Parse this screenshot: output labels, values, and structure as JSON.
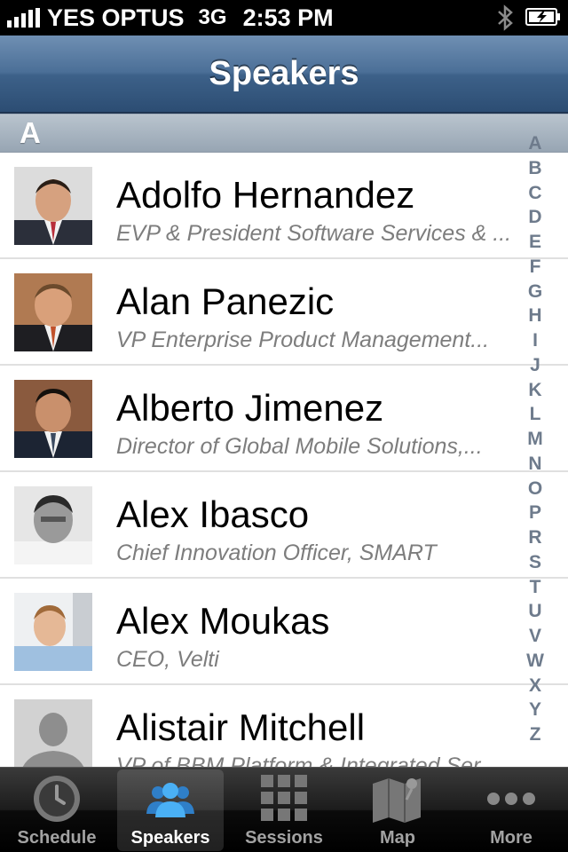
{
  "status_bar": {
    "carrier": "YES OPTUS",
    "network": "3G",
    "time": "2:53 PM"
  },
  "nav": {
    "title": "Speakers"
  },
  "section": {
    "letter": "A"
  },
  "speakers": [
    {
      "name": "Adolfo Hernandez",
      "title": "EVP & President Software Services & ..."
    },
    {
      "name": "Alan Panezic",
      "title": "VP Enterprise Product Management..."
    },
    {
      "name": "Alberto Jimenez",
      "title": "Director of Global Mobile Solutions,..."
    },
    {
      "name": "Alex Ibasco",
      "title": "Chief Innovation Officer, SMART"
    },
    {
      "name": "Alex Moukas",
      "title": "CEO, Velti"
    },
    {
      "name": "Alistair Mitchell",
      "title": "VP of BBM Platform & Integrated Ser..."
    }
  ],
  "index": [
    "A",
    "B",
    "C",
    "D",
    "E",
    "F",
    "G",
    "H",
    "I",
    "J",
    "K",
    "L",
    "M",
    "N",
    "O",
    "P",
    "R",
    "S",
    "T",
    "U",
    "V",
    "W",
    "X",
    "Y",
    "Z"
  ],
  "tabs": [
    {
      "label": "Schedule",
      "icon": "clock-icon",
      "selected": false
    },
    {
      "label": "Speakers",
      "icon": "people-icon",
      "selected": true
    },
    {
      "label": "Sessions",
      "icon": "grid-icon",
      "selected": false
    },
    {
      "label": "Map",
      "icon": "map-icon",
      "selected": false
    },
    {
      "label": "More",
      "icon": "more-icon",
      "selected": false
    }
  ],
  "colors": {
    "nav_bar": "#3d6189",
    "section_header": "#a7b3bf",
    "index_text": "#6e7b8c",
    "subtitle_text": "#7d7d7d",
    "tab_selected_icon": "#3d9be9"
  }
}
